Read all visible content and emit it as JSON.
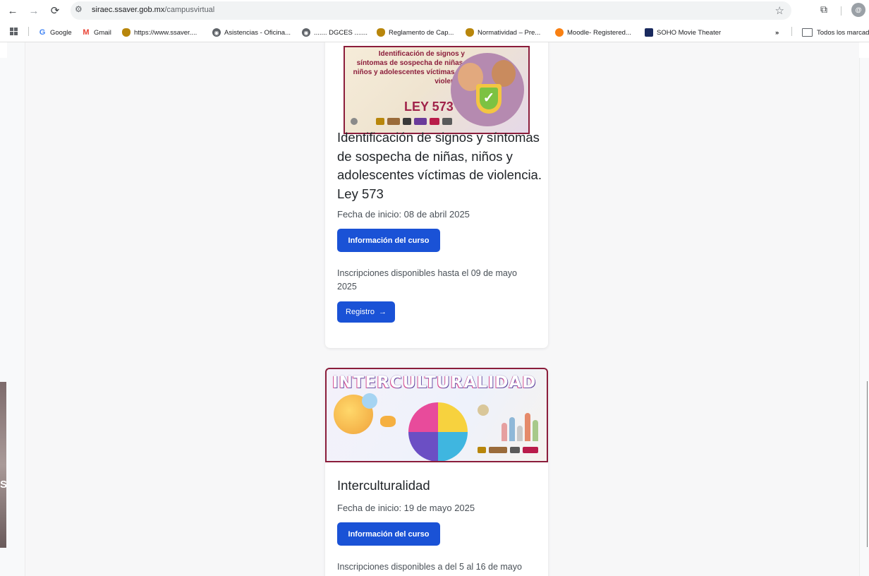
{
  "browser": {
    "url_domain": "siraec.ssaver.gob.mx",
    "url_path": "/campusvirtual",
    "bookmarks": [
      {
        "label": "Google",
        "icon": "google-icon"
      },
      {
        "label": "Gmail",
        "icon": "gmail-icon"
      },
      {
        "label": "https://www.ssaver....",
        "icon": "seal-icon"
      },
      {
        "label": "Asistencias - Oficina...",
        "icon": "globe-icon"
      },
      {
        "label": "....... DGCES .......",
        "icon": "globe-icon"
      },
      {
        "label": "Reglamento de Cap...",
        "icon": "seal-icon"
      },
      {
        "label": "Normatividad – Pre...",
        "icon": "seal-icon"
      },
      {
        "label": "Moodle- Registered...",
        "icon": "moodle-icon"
      },
      {
        "label": "SOHO Movie Theater",
        "icon": "soho-icon"
      }
    ],
    "more_bookmarks": "»",
    "all_bookmarks": "Todos los marcad"
  },
  "courses": [
    {
      "banner_text": "Identificación de signos y síntomas de sospecha de niñas, niños y adolescentes víctimas de violencia",
      "banner_law": "LEY 573",
      "title": "Identificación de signos y síntomas de sospecha de niñas, niños y adolescentes víctimas de violencia. Ley 573",
      "start_date": "Fecha de inicio: 08 de abril 2025",
      "info_button": "Información del curso",
      "registration_text": "Inscripciones disponibles hasta el 09 de mayo 2025",
      "register_button": "Registro"
    },
    {
      "banner_text": "INTERCULTURALIDAD",
      "title": "Interculturalidad",
      "start_date": "Fecha de inicio: 19 de mayo 2025",
      "info_button": "Información del curso",
      "registration_text": "Inscripciones disponibles a del 5 al 16 de mayo"
    }
  ],
  "colors": {
    "primary_button": "#1a52d6",
    "banner_border": "#8b1d3b"
  }
}
